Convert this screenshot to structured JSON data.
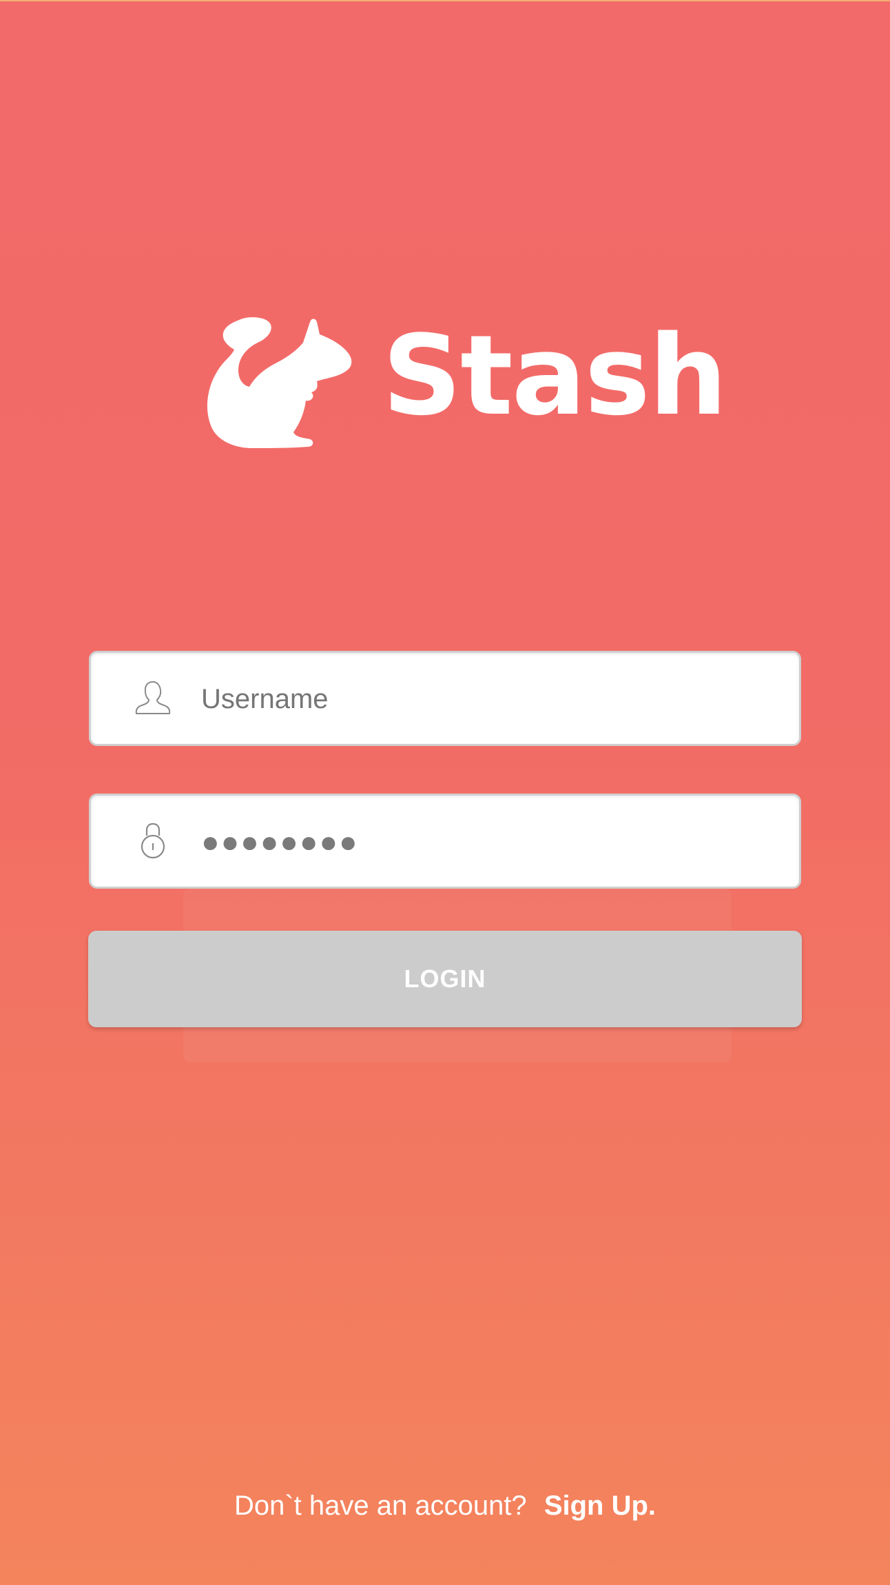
{
  "app": {
    "name": "Stash"
  },
  "login_form": {
    "username_placeholder": "Username",
    "password_mask": "●●●●●●●●",
    "login_label": "LOGIN"
  },
  "footer": {
    "question": "Don`t have an account?",
    "signup_label": "Sign Up."
  },
  "colors": {
    "background_top": "#f26a6a",
    "background_bottom": "#f3845c",
    "button_disabled": "#cccccc",
    "text_white": "#ffffff",
    "placeholder": "#7a7a7a"
  },
  "icons": {
    "logo": "squirrel-icon",
    "username": "user-icon",
    "password": "lock-icon"
  }
}
